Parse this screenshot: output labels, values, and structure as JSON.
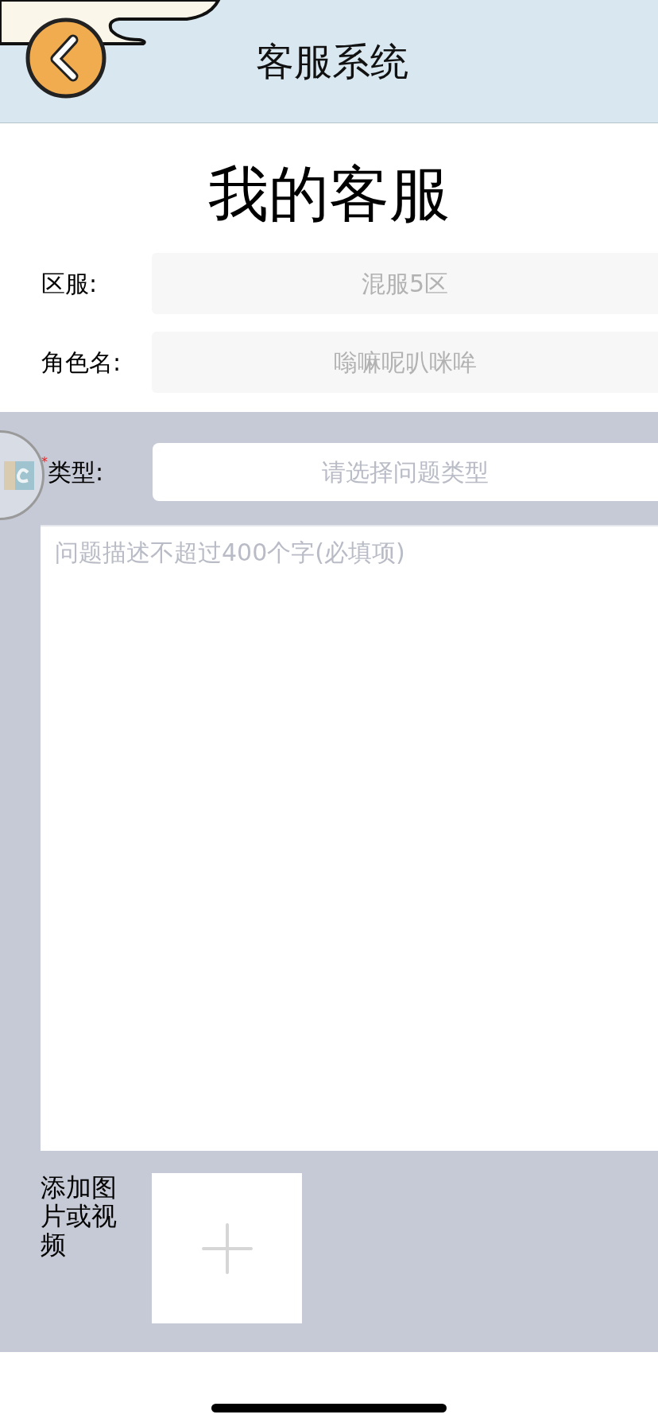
{
  "header": {
    "title": "客服系统"
  },
  "heading": "我的客服",
  "info_rows": [
    {
      "label": "区服:",
      "value": "混服5区"
    },
    {
      "label": "角色名:",
      "value": "嗡嘛呢叭咪哞"
    }
  ],
  "type_field": {
    "required_mark": "*",
    "label": "类型:",
    "placeholder": "请选择问题类型"
  },
  "description": {
    "placeholder": "问题描述不超过400个字(必填项)"
  },
  "attachment": {
    "label": "添加图片或视频"
  }
}
